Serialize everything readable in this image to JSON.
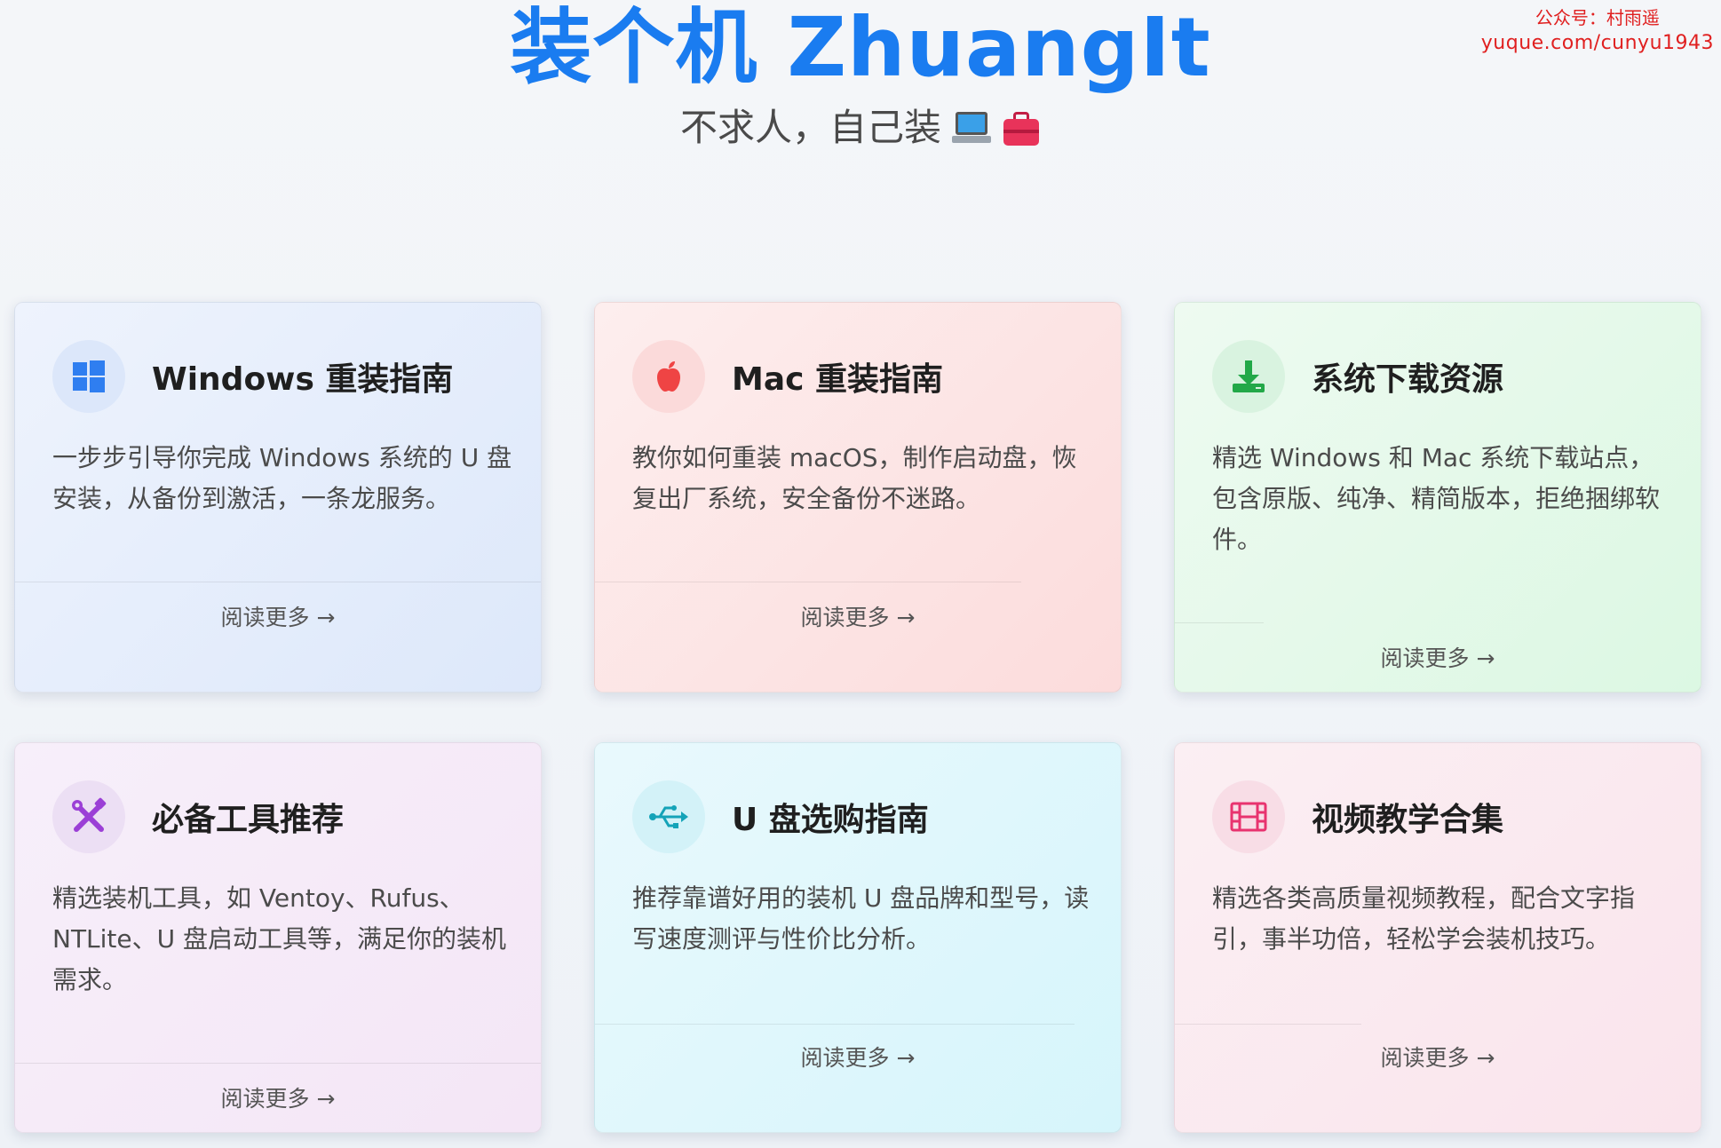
{
  "watermark": {
    "line1": "公众号：村雨遥",
    "line2": "yuque.com/cunyu1943"
  },
  "header": {
    "title": "装个机 ZhuangIt",
    "subtitle": "不求人，自己装"
  },
  "icons": {
    "subtitle_icons": [
      "laptop-icon",
      "toolbox-icon"
    ]
  },
  "colors": {
    "title": "#1a7cf0",
    "watermark": "#e02020"
  },
  "cards": [
    {
      "title": "Windows 重装指南",
      "icon": "windows-icon",
      "desc": "一步步引导你完成 Windows 系统的 U 盘安装，从备份到激活，一条龙服务。",
      "more": "阅读更多 →"
    },
    {
      "title": "Mac 重装指南",
      "icon": "apple-icon",
      "desc": "教你如何重装 macOS，制作启动盘，恢复出厂系统，安全备份不迷路。",
      "more": "阅读更多 →"
    },
    {
      "title": "系统下载资源",
      "icon": "download-icon",
      "desc": "精选 Windows 和 Mac 系统下载站点，包含原版、纯净、精简版本，拒绝捆绑软件。",
      "more": "阅读更多 →"
    },
    {
      "title": "必备工具推荐",
      "icon": "tools-icon",
      "desc": "精选装机工具，如 Ventoy、Rufus、NTLite、U 盘启动工具等，满足你的装机需求。",
      "more": "阅读更多 →"
    },
    {
      "title": "U 盘选购指南",
      "icon": "usb-icon",
      "desc": "推荐靠谱好用的装机 U 盘品牌和型号，读写速度测评与性价比分析。",
      "more": "阅读更多 →"
    },
    {
      "title": "视频教学合集",
      "icon": "film-icon",
      "desc": "精选各类高质量视频教程，配合文字指引，事半功倍，轻松学会装机技巧。",
      "more": "阅读更多 →"
    }
  ]
}
